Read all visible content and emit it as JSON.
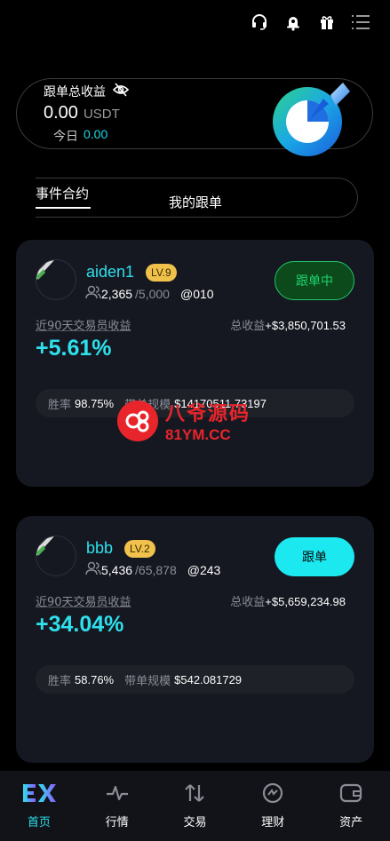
{
  "header": {
    "icons": [
      "headset-icon",
      "bell-icon",
      "gift-icon",
      "menu-icon"
    ]
  },
  "earnings": {
    "title": "跟单总收益",
    "value": "0.00",
    "unit": "USDT",
    "today_label": "今日",
    "today_value": "0.00"
  },
  "tabs": [
    {
      "label": "事件合约",
      "active": true
    },
    {
      "label": "我的跟单",
      "active": false
    }
  ],
  "traders": [
    {
      "name": "aiden1",
      "level": "LV.9",
      "followers": "2,365",
      "max_followers": "/5,000",
      "handle": "@010",
      "button": "跟单中",
      "return_label": "近90天交易员收益",
      "total_label": "总收益",
      "total_value": "+$3,850,701.53",
      "return_pct": "+5.61%",
      "winrate_label": "胜率",
      "winrate": "98.75%",
      "scale_label": "带单规模",
      "scale": "$14170511.73197"
    },
    {
      "name": "bbb",
      "level": "LV.2",
      "followers": "5,436",
      "max_followers": "/65,878",
      "handle": "@243",
      "button": "跟单",
      "return_label": "近90天交易员收益",
      "total_label": "总收益",
      "total_value": "+$5,659,234.98",
      "return_pct": "+34.04%",
      "winrate_label": "胜率",
      "winrate": "58.76%",
      "scale_label": "带单规模",
      "scale": "$542.081729"
    }
  ],
  "watermark": {
    "cn": "八爷源码",
    "en": "81YM.CC"
  },
  "bottom_nav": [
    {
      "label": "首页",
      "icon": "ex-logo-icon",
      "active": true
    },
    {
      "label": "行情",
      "icon": "pulse-icon",
      "active": false
    },
    {
      "label": "交易",
      "icon": "swap-arrows-icon",
      "active": false
    },
    {
      "label": "理财",
      "icon": "finance-icon",
      "active": false
    },
    {
      "label": "资产",
      "icon": "wallet-icon",
      "active": false
    }
  ],
  "colors": {
    "accent": "#2de0ec",
    "following": "#1fd36d",
    "level_badge": "#f0c24b",
    "background": "#000000",
    "card": "#161821"
  }
}
